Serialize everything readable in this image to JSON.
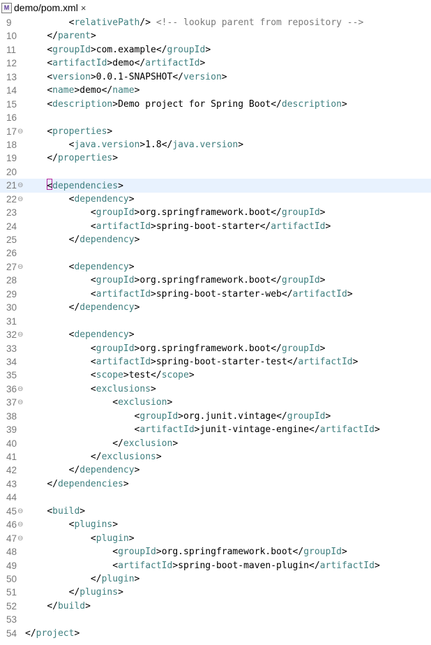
{
  "tab": {
    "title": "demo/pom.xml",
    "close_icon": "×"
  },
  "lines": [
    {
      "n": "9",
      "indent": 2,
      "parts": [
        [
          "b",
          "<"
        ],
        [
          "t",
          "relativePath"
        ],
        [
          "b",
          "/> "
        ],
        [
          "c",
          "<!-- lookup parent from repository -->"
        ]
      ]
    },
    {
      "n": "10",
      "indent": 1,
      "parts": [
        [
          "b",
          "</"
        ],
        [
          "t",
          "parent"
        ],
        [
          "b",
          ">"
        ]
      ]
    },
    {
      "n": "11",
      "indent": 1,
      "parts": [
        [
          "b",
          "<"
        ],
        [
          "t",
          "groupId"
        ],
        [
          "b",
          ">"
        ],
        [
          "x",
          "com.example"
        ],
        [
          "b",
          "</"
        ],
        [
          "t",
          "groupId"
        ],
        [
          "b",
          ">"
        ]
      ]
    },
    {
      "n": "12",
      "indent": 1,
      "parts": [
        [
          "b",
          "<"
        ],
        [
          "t",
          "artifactId"
        ],
        [
          "b",
          ">"
        ],
        [
          "x",
          "demo"
        ],
        [
          "b",
          "</"
        ],
        [
          "t",
          "artifactId"
        ],
        [
          "b",
          ">"
        ]
      ]
    },
    {
      "n": "13",
      "indent": 1,
      "parts": [
        [
          "b",
          "<"
        ],
        [
          "t",
          "version"
        ],
        [
          "b",
          ">"
        ],
        [
          "x",
          "0.0.1-SNAPSHOT"
        ],
        [
          "b",
          "</"
        ],
        [
          "t",
          "version"
        ],
        [
          "b",
          ">"
        ]
      ]
    },
    {
      "n": "14",
      "indent": 1,
      "parts": [
        [
          "b",
          "<"
        ],
        [
          "t",
          "name"
        ],
        [
          "b",
          ">"
        ],
        [
          "x",
          "demo"
        ],
        [
          "b",
          "</"
        ],
        [
          "t",
          "name"
        ],
        [
          "b",
          ">"
        ]
      ]
    },
    {
      "n": "15",
      "indent": 1,
      "parts": [
        [
          "b",
          "<"
        ],
        [
          "t",
          "description"
        ],
        [
          "b",
          ">"
        ],
        [
          "x",
          "Demo project for Spring Boot"
        ],
        [
          "b",
          "</"
        ],
        [
          "t",
          "description"
        ],
        [
          "b",
          ">"
        ]
      ]
    },
    {
      "n": "16",
      "indent": 0,
      "parts": []
    },
    {
      "n": "17",
      "fold": true,
      "indent": 1,
      "parts": [
        [
          "b",
          "<"
        ],
        [
          "t",
          "properties"
        ],
        [
          "b",
          ">"
        ]
      ]
    },
    {
      "n": "18",
      "indent": 2,
      "parts": [
        [
          "b",
          "<"
        ],
        [
          "t",
          "java.version"
        ],
        [
          "b",
          ">"
        ],
        [
          "x",
          "1.8"
        ],
        [
          "b",
          "</"
        ],
        [
          "t",
          "java.version"
        ],
        [
          "b",
          ">"
        ]
      ]
    },
    {
      "n": "19",
      "indent": 1,
      "parts": [
        [
          "b",
          "</"
        ],
        [
          "t",
          "properties"
        ],
        [
          "b",
          ">"
        ]
      ]
    },
    {
      "n": "20",
      "indent": 0,
      "parts": []
    },
    {
      "n": "21",
      "fold": true,
      "current": true,
      "indent": 1,
      "caret": true,
      "parts": [
        [
          "b",
          "<"
        ],
        [
          "t",
          "dependencies"
        ],
        [
          "b",
          ">"
        ]
      ]
    },
    {
      "n": "22",
      "fold": true,
      "indent": 2,
      "parts": [
        [
          "b",
          "<"
        ],
        [
          "t",
          "dependency"
        ],
        [
          "b",
          ">"
        ]
      ]
    },
    {
      "n": "23",
      "indent": 3,
      "parts": [
        [
          "b",
          "<"
        ],
        [
          "t",
          "groupId"
        ],
        [
          "b",
          ">"
        ],
        [
          "x",
          "org.springframework.boot"
        ],
        [
          "b",
          "</"
        ],
        [
          "t",
          "groupId"
        ],
        [
          "b",
          ">"
        ]
      ]
    },
    {
      "n": "24",
      "indent": 3,
      "parts": [
        [
          "b",
          "<"
        ],
        [
          "t",
          "artifactId"
        ],
        [
          "b",
          ">"
        ],
        [
          "x",
          "spring-boot-starter"
        ],
        [
          "b",
          "</"
        ],
        [
          "t",
          "artifactId"
        ],
        [
          "b",
          ">"
        ]
      ]
    },
    {
      "n": "25",
      "indent": 2,
      "parts": [
        [
          "b",
          "</"
        ],
        [
          "t",
          "dependency"
        ],
        [
          "b",
          ">"
        ]
      ]
    },
    {
      "n": "26",
      "indent": 0,
      "parts": []
    },
    {
      "n": "27",
      "fold": true,
      "indent": 2,
      "parts": [
        [
          "b",
          "<"
        ],
        [
          "t",
          "dependency"
        ],
        [
          "b",
          ">"
        ]
      ]
    },
    {
      "n": "28",
      "indent": 3,
      "parts": [
        [
          "b",
          "<"
        ],
        [
          "t",
          "groupId"
        ],
        [
          "b",
          ">"
        ],
        [
          "x",
          "org.springframework.boot"
        ],
        [
          "b",
          "</"
        ],
        [
          "t",
          "groupId"
        ],
        [
          "b",
          ">"
        ]
      ]
    },
    {
      "n": "29",
      "indent": 3,
      "parts": [
        [
          "b",
          "<"
        ],
        [
          "t",
          "artifactId"
        ],
        [
          "b",
          ">"
        ],
        [
          "x",
          "spring-boot-starter-web"
        ],
        [
          "b",
          "</"
        ],
        [
          "t",
          "artifactId"
        ],
        [
          "b",
          ">"
        ]
      ]
    },
    {
      "n": "30",
      "indent": 2,
      "parts": [
        [
          "b",
          "</"
        ],
        [
          "t",
          "dependency"
        ],
        [
          "b",
          ">"
        ]
      ]
    },
    {
      "n": "31",
      "indent": 0,
      "parts": []
    },
    {
      "n": "32",
      "fold": true,
      "indent": 2,
      "parts": [
        [
          "b",
          "<"
        ],
        [
          "t",
          "dependency"
        ],
        [
          "b",
          ">"
        ]
      ]
    },
    {
      "n": "33",
      "indent": 3,
      "parts": [
        [
          "b",
          "<"
        ],
        [
          "t",
          "groupId"
        ],
        [
          "b",
          ">"
        ],
        [
          "x",
          "org.springframework.boot"
        ],
        [
          "b",
          "</"
        ],
        [
          "t",
          "groupId"
        ],
        [
          "b",
          ">"
        ]
      ]
    },
    {
      "n": "34",
      "indent": 3,
      "parts": [
        [
          "b",
          "<"
        ],
        [
          "t",
          "artifactId"
        ],
        [
          "b",
          ">"
        ],
        [
          "x",
          "spring-boot-starter-test"
        ],
        [
          "b",
          "</"
        ],
        [
          "t",
          "artifactId"
        ],
        [
          "b",
          ">"
        ]
      ]
    },
    {
      "n": "35",
      "indent": 3,
      "parts": [
        [
          "b",
          "<"
        ],
        [
          "t",
          "scope"
        ],
        [
          "b",
          ">"
        ],
        [
          "x",
          "test"
        ],
        [
          "b",
          "</"
        ],
        [
          "t",
          "scope"
        ],
        [
          "b",
          ">"
        ]
      ]
    },
    {
      "n": "36",
      "fold": true,
      "indent": 3,
      "parts": [
        [
          "b",
          "<"
        ],
        [
          "t",
          "exclusions"
        ],
        [
          "b",
          ">"
        ]
      ]
    },
    {
      "n": "37",
      "fold": true,
      "indent": 4,
      "parts": [
        [
          "b",
          "<"
        ],
        [
          "t",
          "exclusion"
        ],
        [
          "b",
          ">"
        ]
      ]
    },
    {
      "n": "38",
      "indent": 5,
      "parts": [
        [
          "b",
          "<"
        ],
        [
          "t",
          "groupId"
        ],
        [
          "b",
          ">"
        ],
        [
          "x",
          "org.junit.vintage"
        ],
        [
          "b",
          "</"
        ],
        [
          "t",
          "groupId"
        ],
        [
          "b",
          ">"
        ]
      ]
    },
    {
      "n": "39",
      "indent": 5,
      "parts": [
        [
          "b",
          "<"
        ],
        [
          "t",
          "artifactId"
        ],
        [
          "b",
          ">"
        ],
        [
          "x",
          "junit-vintage-engine"
        ],
        [
          "b",
          "</"
        ],
        [
          "t",
          "artifactId"
        ],
        [
          "b",
          ">"
        ]
      ]
    },
    {
      "n": "40",
      "indent": 4,
      "parts": [
        [
          "b",
          "</"
        ],
        [
          "t",
          "exclusion"
        ],
        [
          "b",
          ">"
        ]
      ]
    },
    {
      "n": "41",
      "indent": 3,
      "parts": [
        [
          "b",
          "</"
        ],
        [
          "t",
          "exclusions"
        ],
        [
          "b",
          ">"
        ]
      ]
    },
    {
      "n": "42",
      "indent": 2,
      "parts": [
        [
          "b",
          "</"
        ],
        [
          "t",
          "dependency"
        ],
        [
          "b",
          ">"
        ]
      ]
    },
    {
      "n": "43",
      "indent": 1,
      "parts": [
        [
          "b",
          "</"
        ],
        [
          "t",
          "dependencies"
        ],
        [
          "b",
          ">"
        ]
      ]
    },
    {
      "n": "44",
      "indent": 0,
      "parts": []
    },
    {
      "n": "45",
      "fold": true,
      "indent": 1,
      "parts": [
        [
          "b",
          "<"
        ],
        [
          "t",
          "build"
        ],
        [
          "b",
          ">"
        ]
      ]
    },
    {
      "n": "46",
      "fold": true,
      "indent": 2,
      "parts": [
        [
          "b",
          "<"
        ],
        [
          "t",
          "plugins"
        ],
        [
          "b",
          ">"
        ]
      ]
    },
    {
      "n": "47",
      "fold": true,
      "indent": 3,
      "parts": [
        [
          "b",
          "<"
        ],
        [
          "t",
          "plugin"
        ],
        [
          "b",
          ">"
        ]
      ]
    },
    {
      "n": "48",
      "indent": 4,
      "parts": [
        [
          "b",
          "<"
        ],
        [
          "t",
          "groupId"
        ],
        [
          "b",
          ">"
        ],
        [
          "x",
          "org.springframework.boot"
        ],
        [
          "b",
          "</"
        ],
        [
          "t",
          "groupId"
        ],
        [
          "b",
          ">"
        ]
      ]
    },
    {
      "n": "49",
      "indent": 4,
      "parts": [
        [
          "b",
          "<"
        ],
        [
          "t",
          "artifactId"
        ],
        [
          "b",
          ">"
        ],
        [
          "x",
          "spring-boot-maven-plugin"
        ],
        [
          "b",
          "</"
        ],
        [
          "t",
          "artifactId"
        ],
        [
          "b",
          ">"
        ]
      ]
    },
    {
      "n": "50",
      "indent": 3,
      "parts": [
        [
          "b",
          "</"
        ],
        [
          "t",
          "plugin"
        ],
        [
          "b",
          ">"
        ]
      ]
    },
    {
      "n": "51",
      "indent": 2,
      "parts": [
        [
          "b",
          "</"
        ],
        [
          "t",
          "plugins"
        ],
        [
          "b",
          ">"
        ]
      ]
    },
    {
      "n": "52",
      "indent": 1,
      "parts": [
        [
          "b",
          "</"
        ],
        [
          "t",
          "build"
        ],
        [
          "b",
          ">"
        ]
      ]
    },
    {
      "n": "53",
      "indent": 0,
      "parts": []
    },
    {
      "n": "54",
      "indent": 0,
      "parts": [
        [
          "b",
          "</"
        ],
        [
          "t",
          "project"
        ],
        [
          "b",
          ">"
        ]
      ]
    }
  ]
}
